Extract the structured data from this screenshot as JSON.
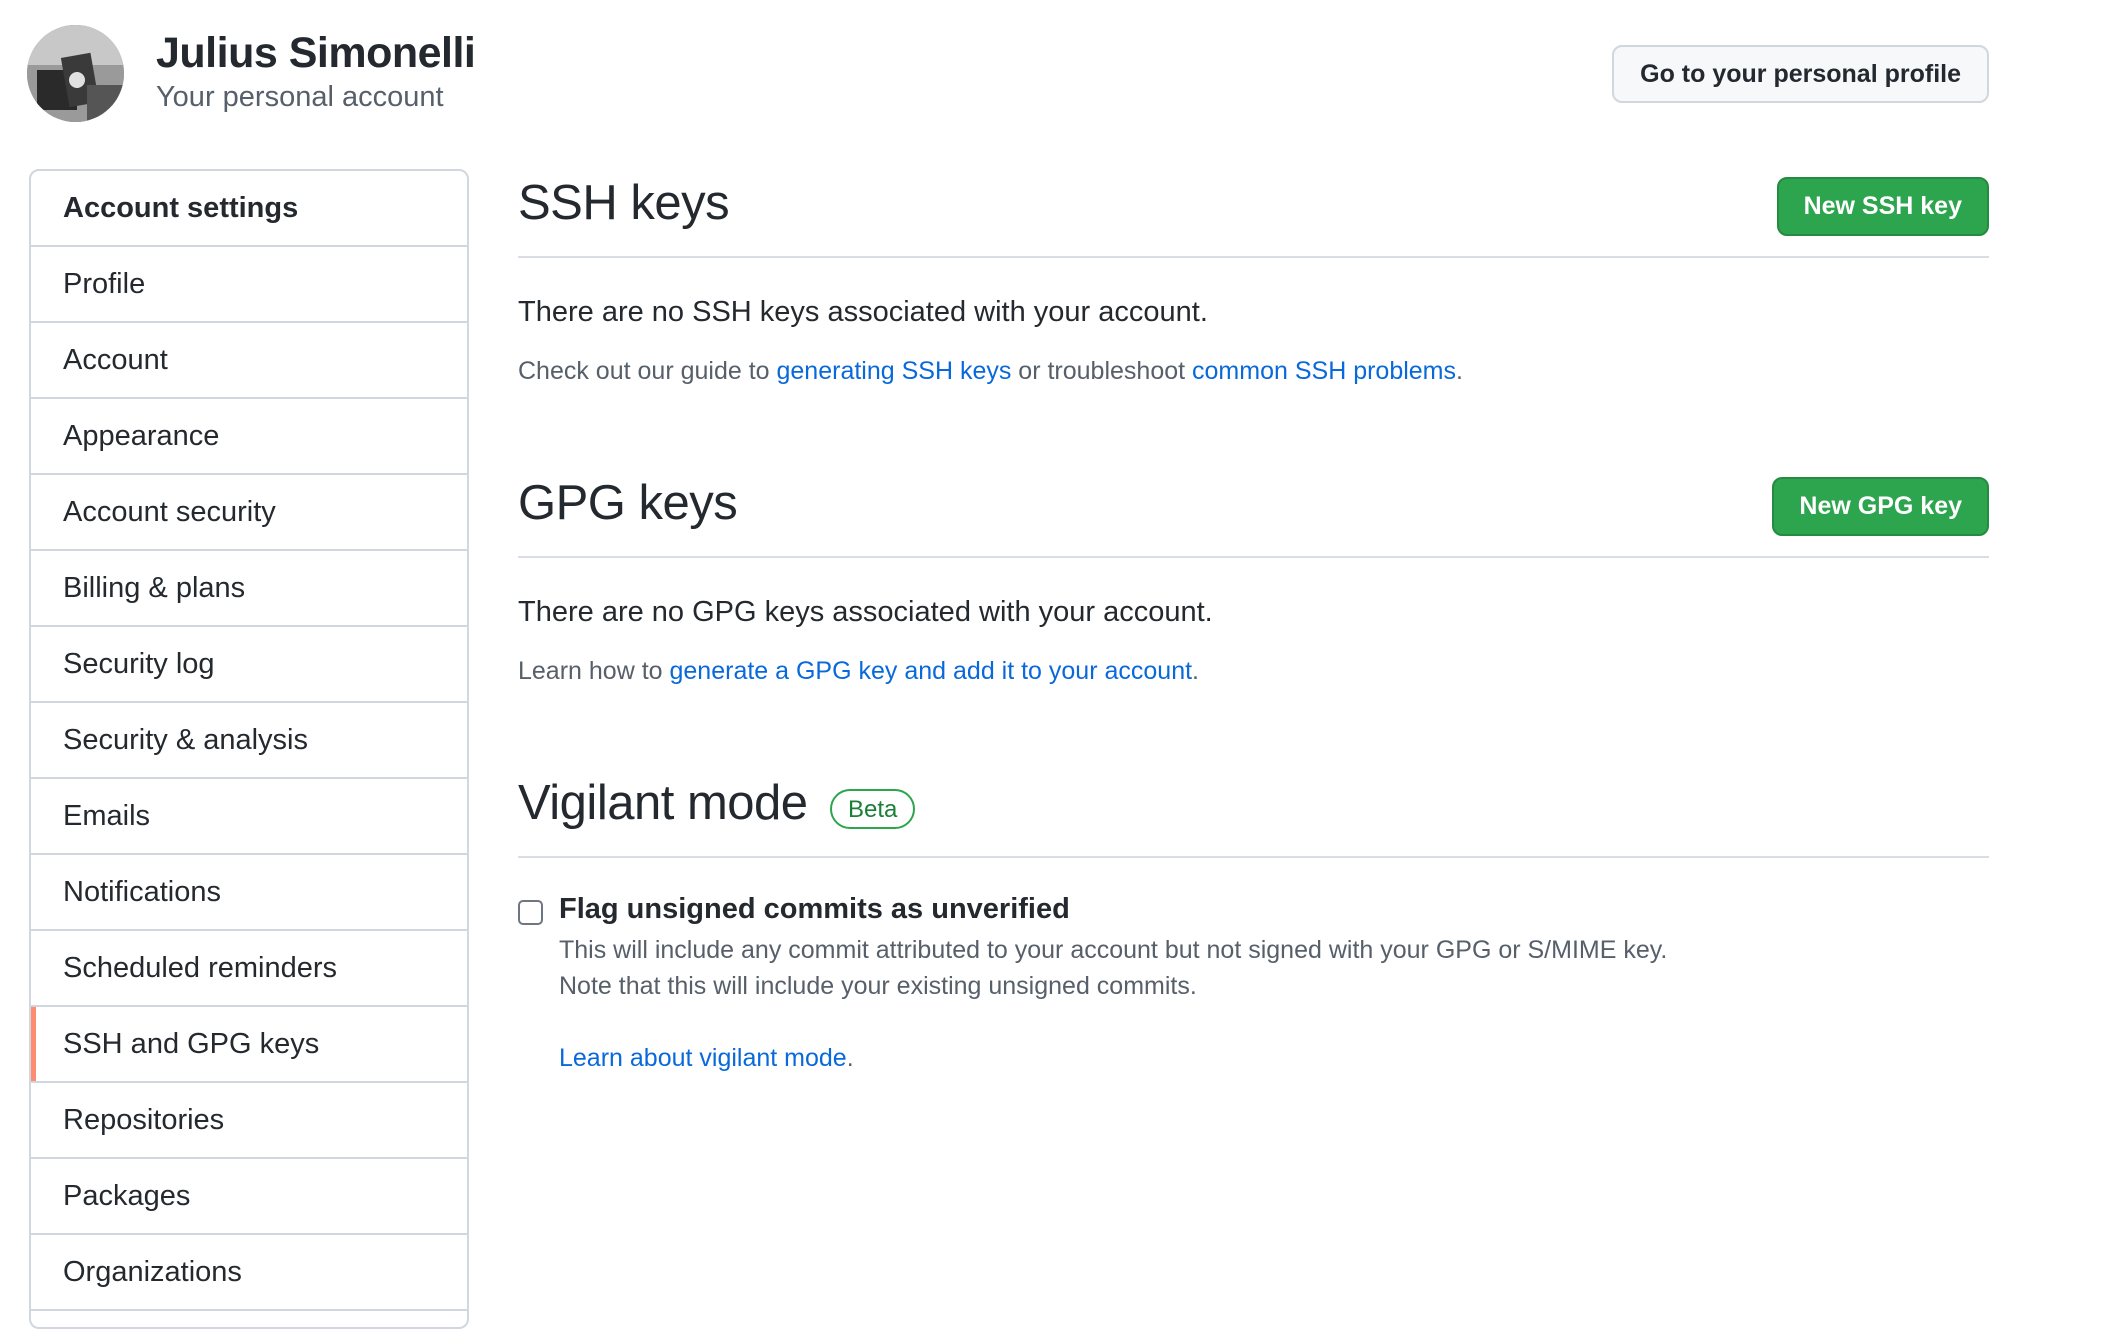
{
  "header": {
    "user_name": "Julius Simonelli",
    "user_subtitle": "Your personal account",
    "profile_button": "Go to your personal profile"
  },
  "sidebar": {
    "items": [
      {
        "label": "Account settings",
        "heading": true
      },
      {
        "label": "Profile"
      },
      {
        "label": "Account"
      },
      {
        "label": "Appearance"
      },
      {
        "label": "Account security"
      },
      {
        "label": "Billing & plans"
      },
      {
        "label": "Security log"
      },
      {
        "label": "Security & analysis"
      },
      {
        "label": "Emails"
      },
      {
        "label": "Notifications"
      },
      {
        "label": "Scheduled reminders"
      },
      {
        "label": "SSH and GPG keys",
        "active": true
      },
      {
        "label": "Repositories"
      },
      {
        "label": "Packages"
      },
      {
        "label": "Organizations"
      }
    ]
  },
  "ssh": {
    "title": "SSH keys",
    "button": "New SSH key",
    "empty_text": "There are no SSH keys associated with your account.",
    "guide_prefix": "Check out our guide to ",
    "guide_link": "generating SSH keys",
    "guide_middle": " or troubleshoot ",
    "problems_link": "common SSH problems",
    "guide_suffix": "."
  },
  "gpg": {
    "title": "GPG keys",
    "button": "New GPG key",
    "empty_text": "There are no GPG keys associated with your account.",
    "learn_prefix": "Learn how to ",
    "learn_link": "generate a GPG key and add it to your account",
    "learn_suffix": "."
  },
  "vigilant": {
    "title": "Vigilant mode",
    "badge": "Beta",
    "checkbox_label": "Flag unsigned commits as unverified",
    "checkbox_checked": false,
    "desc_line1": "This will include any commit attributed to your account but not signed with your GPG or S/MIME key.",
    "desc_line2": "Note that this will include your existing unsigned commits.",
    "learn_link": "Learn about vigilant mode",
    "learn_suffix": "."
  },
  "colors": {
    "primary_button": "#2da44e",
    "link": "#0969da",
    "active_indicator": "#fd8c73"
  }
}
